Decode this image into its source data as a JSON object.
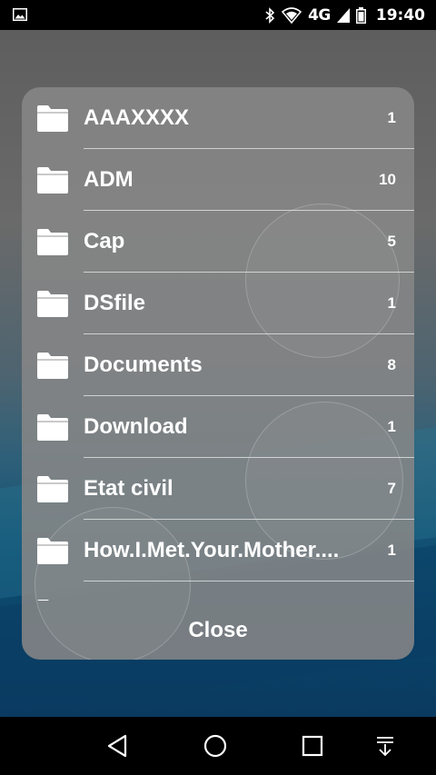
{
  "status_bar": {
    "network": "4G",
    "time": "19:40",
    "icons": [
      "gallery-icon",
      "bluetooth-icon",
      "wifi-icon",
      "signal-icon",
      "battery-icon"
    ]
  },
  "dialog": {
    "folders": [
      {
        "name": "AAAXXXX",
        "count": "1"
      },
      {
        "name": "ADM",
        "count": "10"
      },
      {
        "name": "Cap",
        "count": "5"
      },
      {
        "name": "DSfile",
        "count": "1"
      },
      {
        "name": "Documents",
        "count": "8"
      },
      {
        "name": "Download",
        "count": "1"
      },
      {
        "name": "Etat civil",
        "count": "7"
      },
      {
        "name": "How.I.Met.Your.Mother....",
        "count": "1"
      }
    ],
    "close_label": "Close"
  },
  "nav_bar": {
    "buttons": [
      "back-icon",
      "home-icon",
      "recents-icon",
      "notifications-dropdown-icon"
    ]
  },
  "colors": {
    "dialog_bg": "#868686",
    "text": "#ffffff",
    "wallpaper_top": "#5e5e5e",
    "wallpaper_bottom": "#0a3a5f"
  }
}
